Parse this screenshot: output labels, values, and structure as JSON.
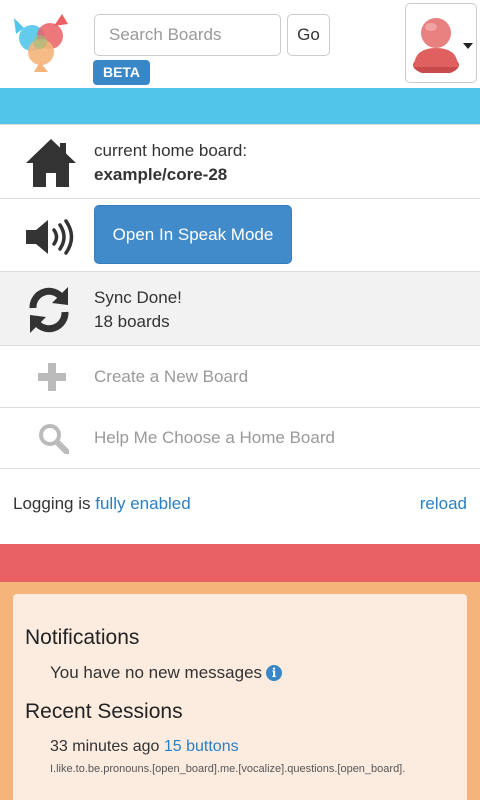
{
  "header": {
    "search": {
      "placeholder": "Search Boards",
      "value": ""
    },
    "go_label": "Go",
    "beta_label": "BETA"
  },
  "home_board": {
    "label": "current home board:",
    "name": "example/core-28"
  },
  "speak": {
    "button_label": "Open In Speak Mode"
  },
  "sync": {
    "status": "Sync Done!",
    "count": "18 boards"
  },
  "actions": {
    "create": "Create a New Board",
    "help": "Help Me Choose a Home Board"
  },
  "logging": {
    "prefix": "Logging is",
    "status_link": "fully enabled",
    "reload": "reload"
  },
  "notifications": {
    "title": "Notifications",
    "message": "You have no new messages",
    "info_glyph": "i"
  },
  "recent_sessions": {
    "title": "Recent Sessions",
    "time": "33 minutes ago",
    "link": "15 buttons",
    "detail": "I.like.to.be.pronouns.[open_board].me.[vocalize].questions.[open_board]."
  },
  "colors": {
    "accent_blue": "#428bca",
    "top_bar": "#52c5ea",
    "alert_bar": "#e96065",
    "orange_bg": "#f4b47a"
  }
}
